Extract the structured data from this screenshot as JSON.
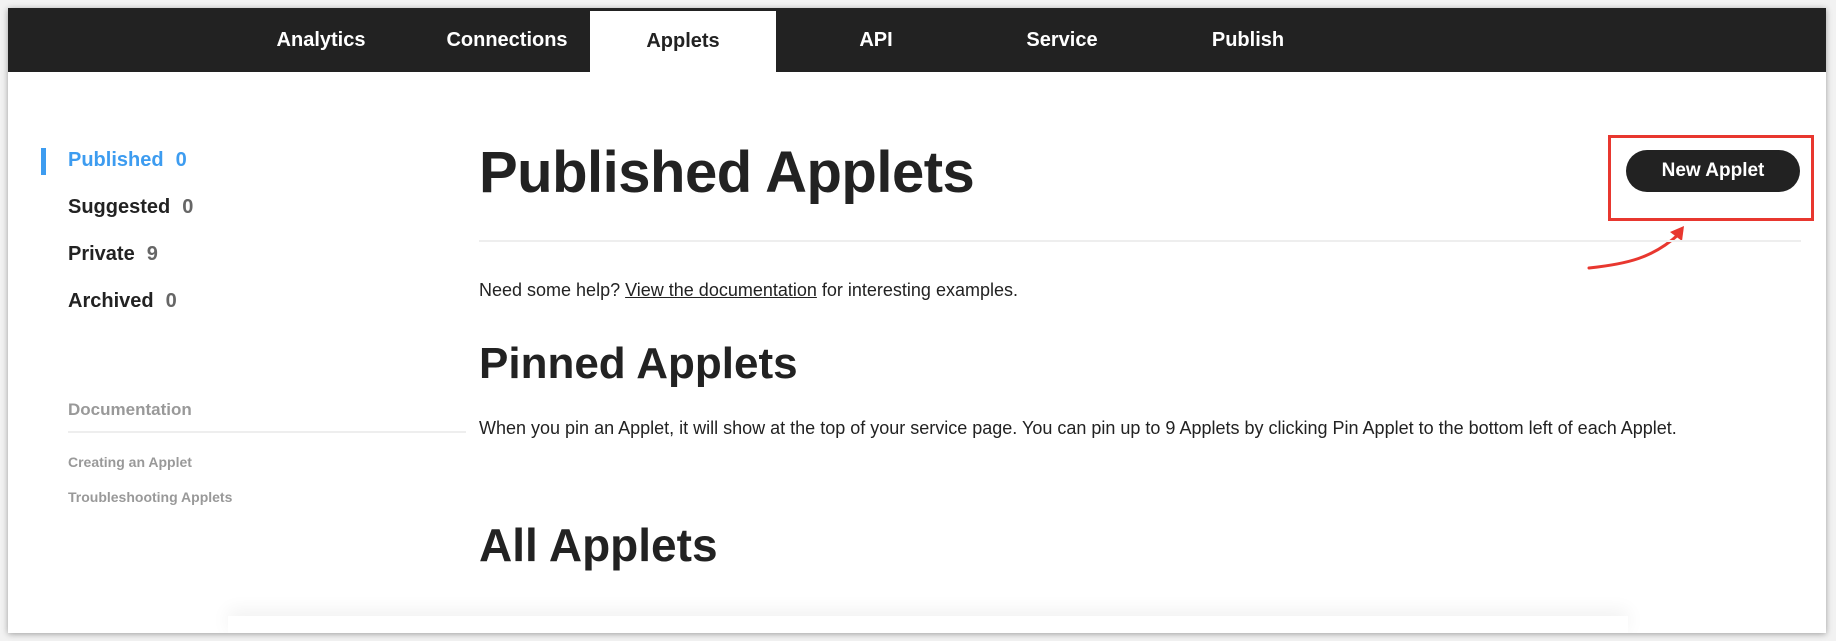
{
  "nav": {
    "tabs": [
      {
        "label": "Analytics"
      },
      {
        "label": "Connections"
      },
      {
        "label": "Applets"
      },
      {
        "label": "API"
      },
      {
        "label": "Service"
      },
      {
        "label": "Publish"
      }
    ],
    "active_tab": "Applets"
  },
  "sidebar": {
    "items": [
      {
        "label": "Published",
        "count": "0"
      },
      {
        "label": "Suggested",
        "count": "0"
      },
      {
        "label": "Private",
        "count": "9"
      },
      {
        "label": "Archived",
        "count": "0"
      }
    ],
    "active_item": "Published",
    "documentation": {
      "heading": "Documentation",
      "links": [
        "Creating an Applet",
        "Troubleshooting Applets"
      ]
    }
  },
  "main": {
    "title": "Published Applets",
    "new_button_label": "New Applet",
    "help": {
      "prefix": "Need some help? ",
      "link": "View the documentation",
      "suffix": " for interesting examples."
    },
    "pinned": {
      "title": "Pinned Applets",
      "description": "When you pin an Applet, it will show at the top of your service page. You can pin up to 9 Applets by clicking Pin Applet to the bottom left of each Applet."
    },
    "all_title": "All Applets"
  },
  "colors": {
    "nav_background": "#222222",
    "accent": "#3d9cf0",
    "annotation": "#e8372f",
    "button": "#222222"
  }
}
